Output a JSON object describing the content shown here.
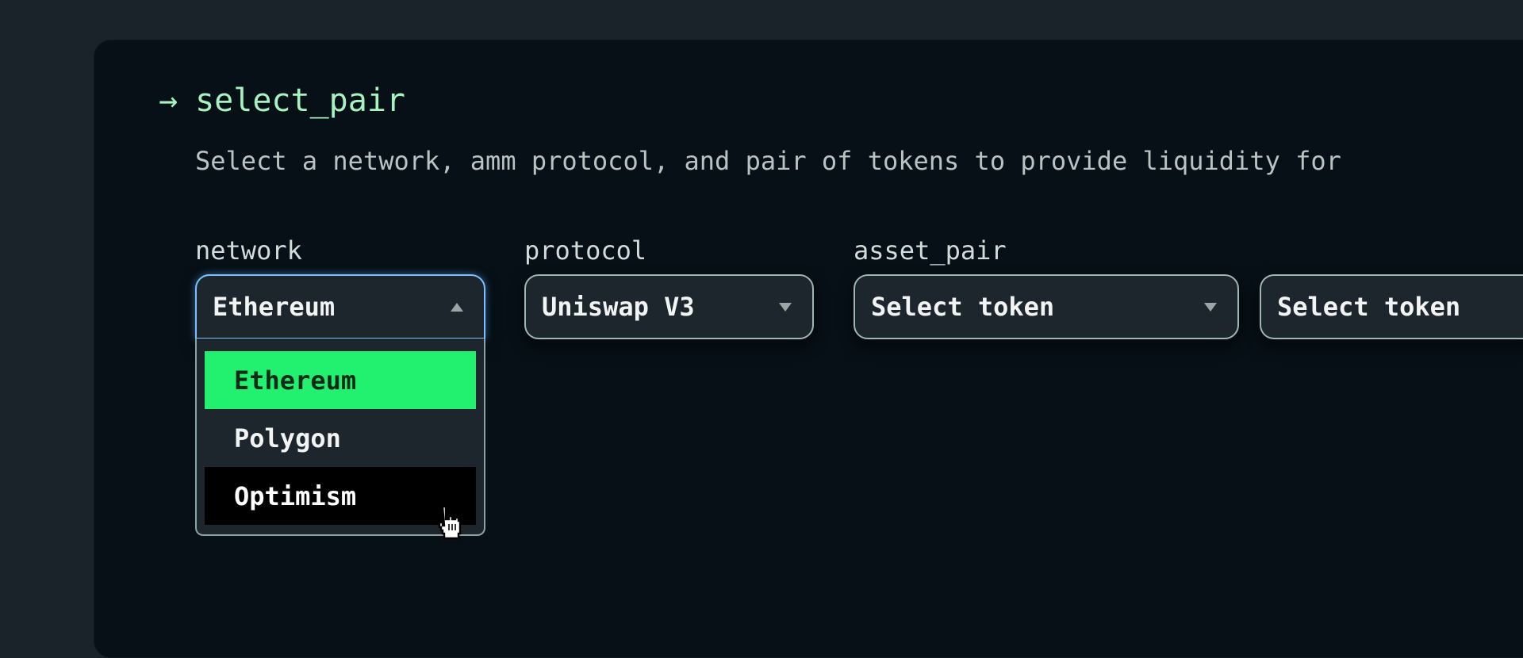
{
  "header": {
    "arrow_icon": "right-arrow-icon",
    "title": "select_pair",
    "subtitle": "Select a network, amm protocol, and pair of tokens to provide liquidity for"
  },
  "fields": {
    "network": {
      "label": "network",
      "value": "Ethereum",
      "open": true,
      "options": [
        "Ethereum",
        "Polygon",
        "Optimism"
      ],
      "selected_option": "Ethereum",
      "hovered_option": "Optimism"
    },
    "protocol": {
      "label": "protocol",
      "value": "Uniswap V3"
    },
    "asset_pair": {
      "label": "asset_pair",
      "token_a_placeholder": "Select token",
      "token_b_placeholder": "Select token"
    }
  },
  "colors": {
    "title": "#a6f2c0",
    "selected_option_bg": "#22f06f",
    "hovered_option_bg": "#000000",
    "focus_border": "#7fbfff"
  }
}
